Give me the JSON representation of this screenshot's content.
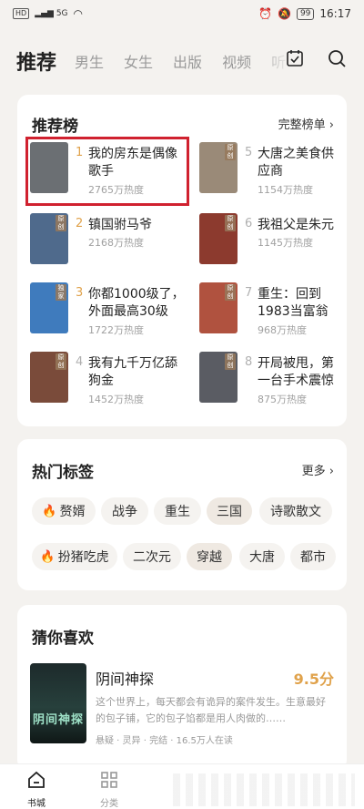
{
  "status_bar": {
    "left_chip": "HD",
    "signal": "5G",
    "battery": "99",
    "time": "16:17"
  },
  "top_tabs": [
    {
      "label": "推荐",
      "active": true
    },
    {
      "label": "男生",
      "active": false
    },
    {
      "label": "女生",
      "active": false
    },
    {
      "label": "出版",
      "active": false
    },
    {
      "label": "视频",
      "active": false
    },
    {
      "label": "听",
      "active": false
    }
  ],
  "top_icons": [
    "calendar-check-icon",
    "search-icon"
  ],
  "rank": {
    "title": "推荐榜",
    "more": "完整榜单 ›",
    "items": [
      {
        "num": "1",
        "name": "我的房东是偶像歌手",
        "heat": "2765万热度",
        "cover": "#6b6f73",
        "tag": ""
      },
      {
        "num": "2",
        "name": "镇国驸马爷",
        "heat": "2168万热度",
        "cover": "#4f6a8c",
        "tag": "原创"
      },
      {
        "num": "3",
        "name": "你都1000级了，外面最高30级",
        "heat": "1722万热度",
        "cover": "#3f7bbd",
        "tag": "独家"
      },
      {
        "num": "4",
        "name": "我有九千万亿舔狗金",
        "heat": "1452万热度",
        "cover": "#7a4b3a",
        "tag": "原创"
      },
      {
        "num": "5",
        "name": "大唐之美食供应商",
        "heat": "1154万热度",
        "cover": "#9a8a78",
        "tag": "原创"
      },
      {
        "num": "6",
        "name": "我祖父是朱元璋",
        "heat": "1145万热度",
        "cover": "#8c3a2e",
        "tag": "原创"
      },
      {
        "num": "7",
        "name": "重生：回到1983当富翁",
        "heat": "968万热度",
        "cover": "#b0523f",
        "tag": "原创"
      },
      {
        "num": "8",
        "name": "开局被甩，第一台手术震惊世界",
        "heat": "875万热度",
        "cover": "#5a5c63",
        "tag": "原创"
      }
    ]
  },
  "tags": {
    "title": "热门标签",
    "more": "更多 ›",
    "row1": [
      {
        "label": "赘婿",
        "hot": true
      },
      {
        "label": "战争",
        "hot": false
      },
      {
        "label": "重生",
        "hot": false
      },
      {
        "label": "三国",
        "hot": false,
        "hl": true
      },
      {
        "label": "诗歌散文",
        "hot": false
      }
    ],
    "row2": [
      {
        "label": "扮猪吃虎",
        "hot": true
      },
      {
        "label": "二次元",
        "hot": false
      },
      {
        "label": "穿越",
        "hot": false,
        "hl": true
      },
      {
        "label": "大唐",
        "hot": false
      },
      {
        "label": "都市",
        "hot": false
      }
    ]
  },
  "guess": {
    "title": "猜你喜欢",
    "book_title": "阴间神探",
    "score": "9.5分",
    "desc": "这个世界上，每天都会有诡异的案件发生。生意最好的包子铺，它的包子馅都是用人肉做的……",
    "meta": "悬疑 · 灵异 · 完结 · 16.5万人在读",
    "cover_text": "阴间神探"
  },
  "bottom_nav": [
    {
      "label": "书城",
      "active": true
    },
    {
      "label": "分类",
      "active": false
    }
  ]
}
